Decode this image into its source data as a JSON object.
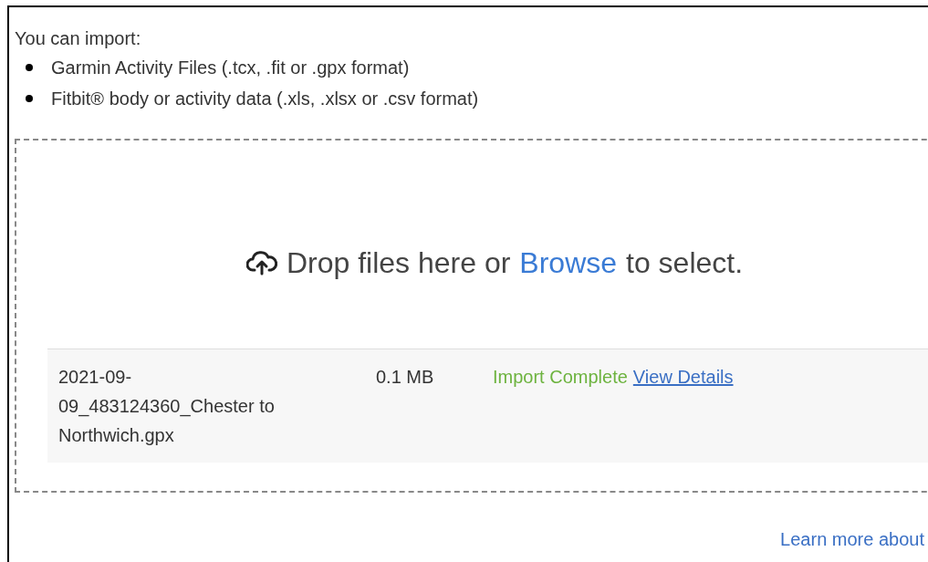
{
  "intro": "You can import:",
  "formats": [
    "Garmin Activity Files (.tcx, .fit or .gpx format)",
    "Fitbit® body or activity data (.xls, .xlsx or .csv format)"
  ],
  "dropzone": {
    "prefix": "Drop files here or",
    "link": "Browse",
    "suffix": "to select."
  },
  "files": [
    {
      "name": "2021-09-09_483124360_Chester to Northwich.gpx",
      "size": "0.1 MB",
      "status": {
        "kind": "success",
        "text": "Import Complete"
      },
      "details_link": "View Details"
    }
  ],
  "footer_link": "Learn more about"
}
